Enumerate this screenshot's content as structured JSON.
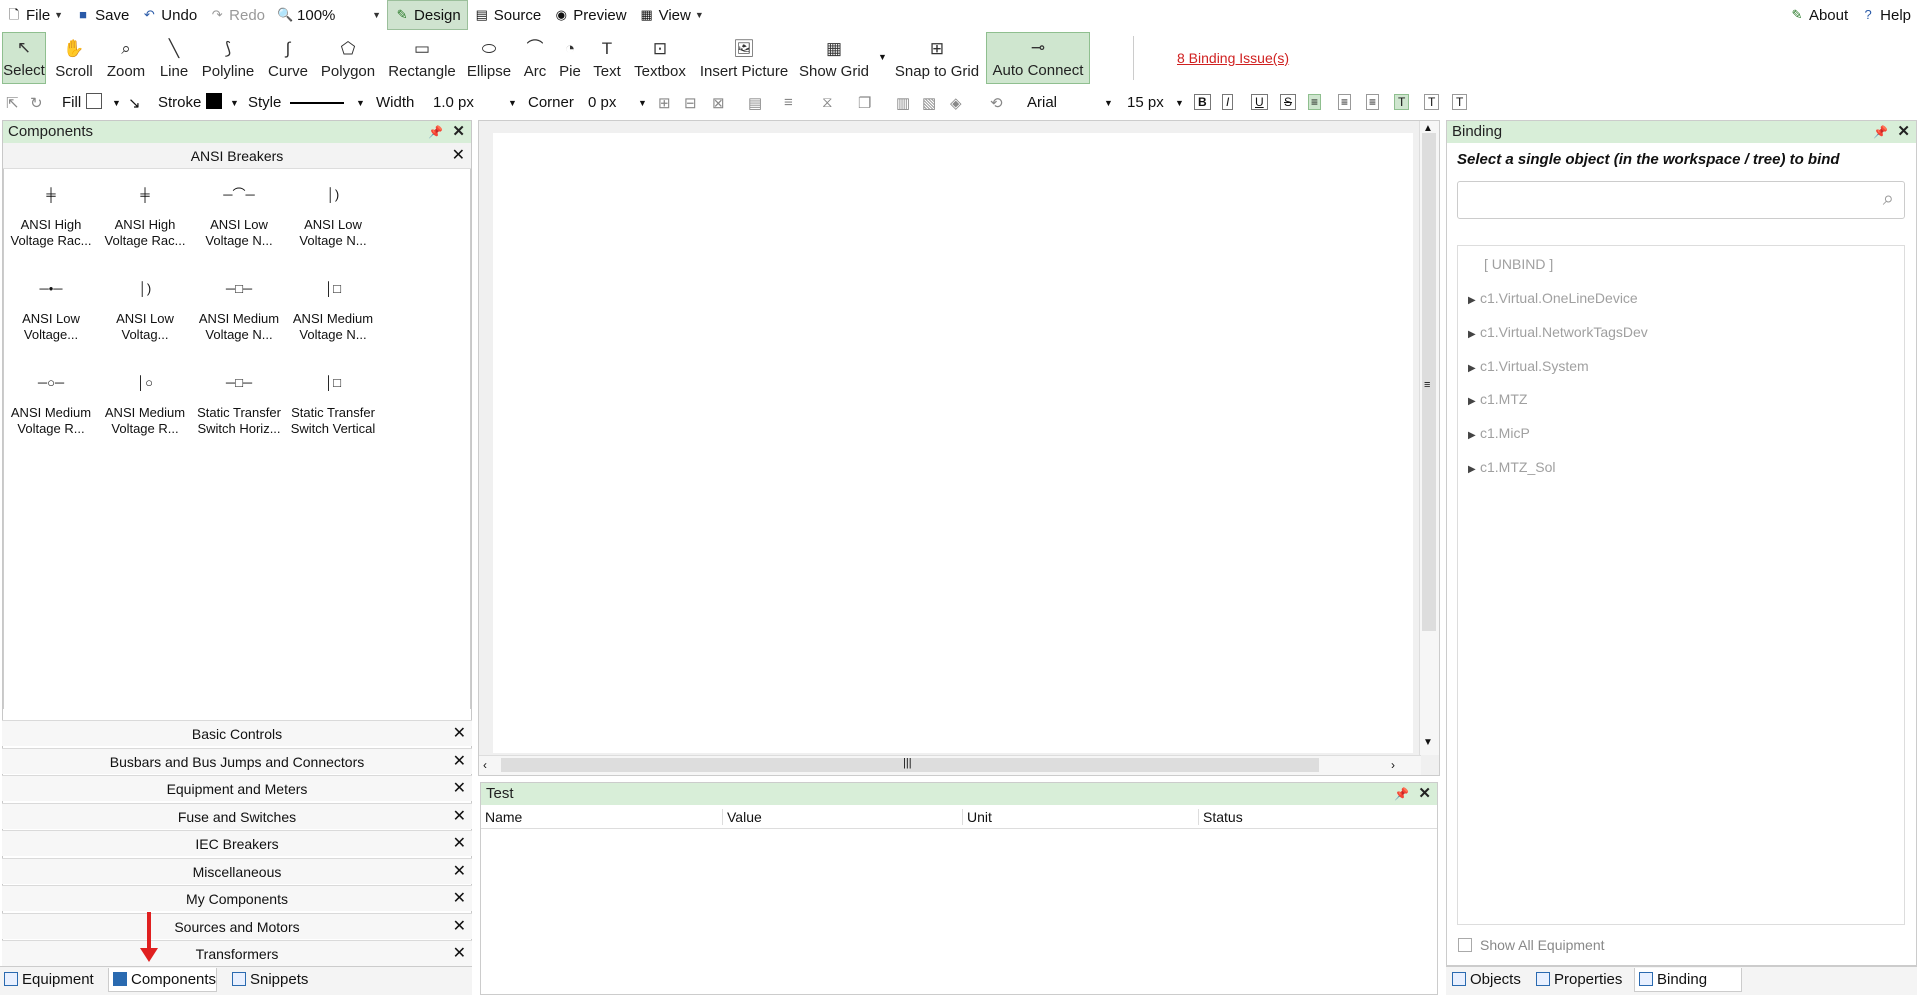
{
  "menu": {
    "file": "File",
    "save": "Save",
    "undo": "Undo",
    "redo": "Redo",
    "zoom": "100%",
    "design": "Design",
    "source": "Source",
    "preview": "Preview",
    "view": "View",
    "about": "About",
    "help": "Help"
  },
  "toolbar": {
    "select": "Select",
    "scroll": "Scroll",
    "zoom": "Zoom",
    "line": "Line",
    "polyline": "Polyline",
    "curve": "Curve",
    "polygon": "Polygon",
    "rectangle": "Rectangle",
    "ellipse": "Ellipse",
    "arc": "Arc",
    "pie": "Pie",
    "text": "Text",
    "textbox": "Textbox",
    "insert_picture": "Insert Picture",
    "show_grid": "Show Grid",
    "snap_to_grid": "Snap to Grid",
    "auto_connect": "Auto Connect",
    "binding_issues": "8 Binding Issue(s)"
  },
  "format": {
    "fill": "Fill",
    "stroke": "Stroke",
    "style": "Style",
    "width_label": "Width",
    "width_value": "1.0 px",
    "corner_label": "Corner",
    "corner_value": "0 px",
    "font": "Arial",
    "font_size": "15 px",
    "bold": "B",
    "italic": "I",
    "underline": "U",
    "strike": "S"
  },
  "components": {
    "title": "Components",
    "open_category": "ANSI Breakers",
    "items": [
      {
        "l1": "ANSI High",
        "l2": "Voltage Rac..."
      },
      {
        "l1": "ANSI High",
        "l2": "Voltage Rac..."
      },
      {
        "l1": "ANSI Low",
        "l2": "Voltage N..."
      },
      {
        "l1": "ANSI Low",
        "l2": "Voltage N..."
      },
      {
        "l1": "ANSI Low",
        "l2": "Voltage..."
      },
      {
        "l1": "ANSI Low",
        "l2": "Voltag..."
      },
      {
        "l1": "ANSI Medium",
        "l2": "Voltage N..."
      },
      {
        "l1": "ANSI Medium",
        "l2": "Voltage N..."
      },
      {
        "l1": "ANSI Medium",
        "l2": "Voltage R..."
      },
      {
        "l1": "ANSI Medium",
        "l2": "Voltage R..."
      },
      {
        "l1": "Static Transfer",
        "l2": "Switch Horiz..."
      },
      {
        "l1": "Static Transfer",
        "l2": "Switch Vertical"
      }
    ],
    "categories": [
      "Basic Controls",
      "Busbars and Bus Jumps and Connectors",
      "Equipment and Meters",
      "Fuse and Switches",
      "IEC Breakers",
      "Miscellaneous",
      "My Components",
      "Sources and Motors",
      "Transformers"
    ]
  },
  "left_tabs": [
    "Equipment",
    "Components",
    "Snippets"
  ],
  "test": {
    "title": "Test",
    "columns": [
      "Name",
      "Value",
      "Unit",
      "Status"
    ]
  },
  "binding": {
    "title": "Binding",
    "instruction": "Select a single object (in the workspace / tree) to bind",
    "search_placeholder": "",
    "unbind": "[ UNBIND ]",
    "tree": [
      "c1.Virtual.OneLineDevice",
      "c1.Virtual.NetworkTagsDev",
      "c1.Virtual.System",
      "c1.MTZ",
      "c1.MicP",
      "c1.MTZ_Sol"
    ],
    "show_all": "Show All Equipment"
  },
  "right_tabs": [
    "Objects",
    "Properties",
    "Binding"
  ]
}
